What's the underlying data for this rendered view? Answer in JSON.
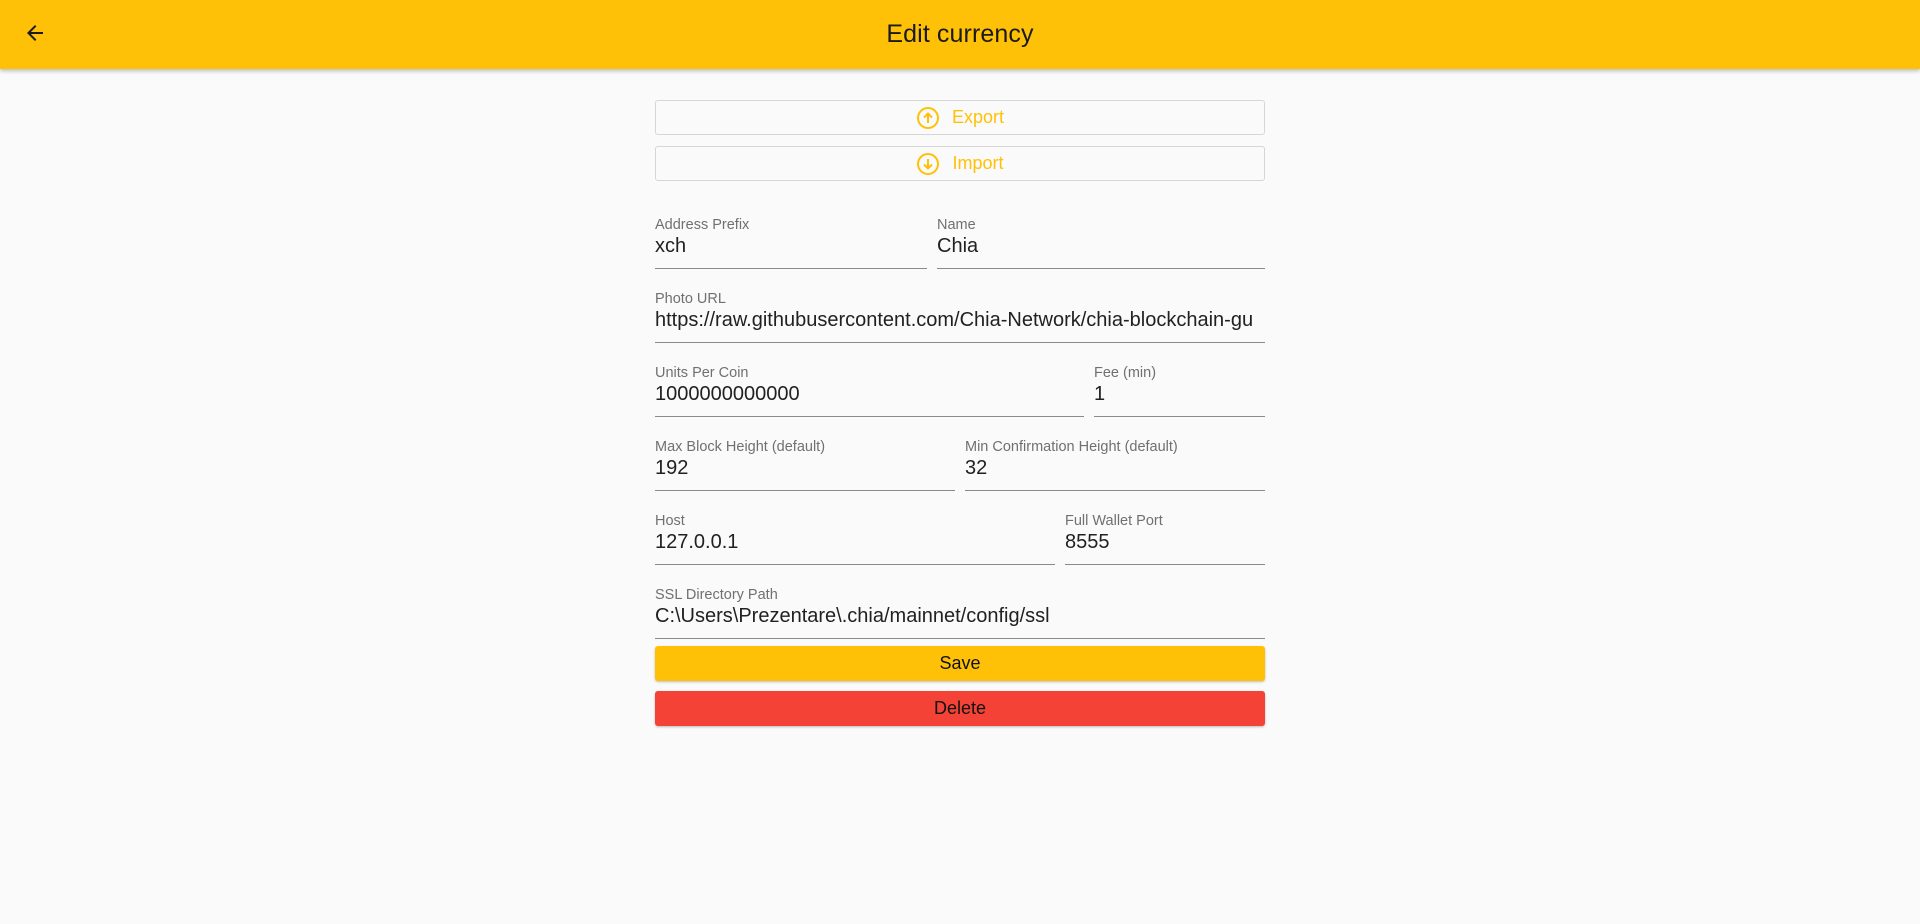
{
  "appbar": {
    "title": "Edit currency",
    "back_icon": "arrow-back-icon"
  },
  "actions_top": {
    "export_label": "Export",
    "export_icon": "upload-circle-icon",
    "import_label": "Import",
    "import_icon": "download-circle-icon"
  },
  "form": {
    "address_prefix": {
      "label": "Address Prefix",
      "value": "xch"
    },
    "name": {
      "label": "Name",
      "value": "Chia"
    },
    "photo_url": {
      "label": "Photo URL",
      "value": "https://raw.githubusercontent.com/Chia-Network/chia-blockchain-gu"
    },
    "units_per_coin": {
      "label": "Units Per Coin",
      "value": "1000000000000"
    },
    "fee_min": {
      "label": "Fee (min)",
      "value": "1"
    },
    "max_block_height": {
      "label": "Max Block Height (default)",
      "value": "192"
    },
    "min_confirmation_height": {
      "label": "Min Confirmation Height (default)",
      "value": "32"
    },
    "host": {
      "label": "Host",
      "value": "127.0.0.1"
    },
    "full_wallet_port": {
      "label": "Full Wallet Port",
      "value": "8555"
    },
    "ssl_directory_path": {
      "label": "SSL Directory Path",
      "value": "C:\\Users\\Prezentare\\.chia/mainnet/config/ssl"
    }
  },
  "buttons": {
    "save_label": "Save",
    "delete_label": "Delete"
  },
  "colors": {
    "accent": "#ffc107",
    "danger": "#f44336",
    "background": "#fafafa"
  }
}
